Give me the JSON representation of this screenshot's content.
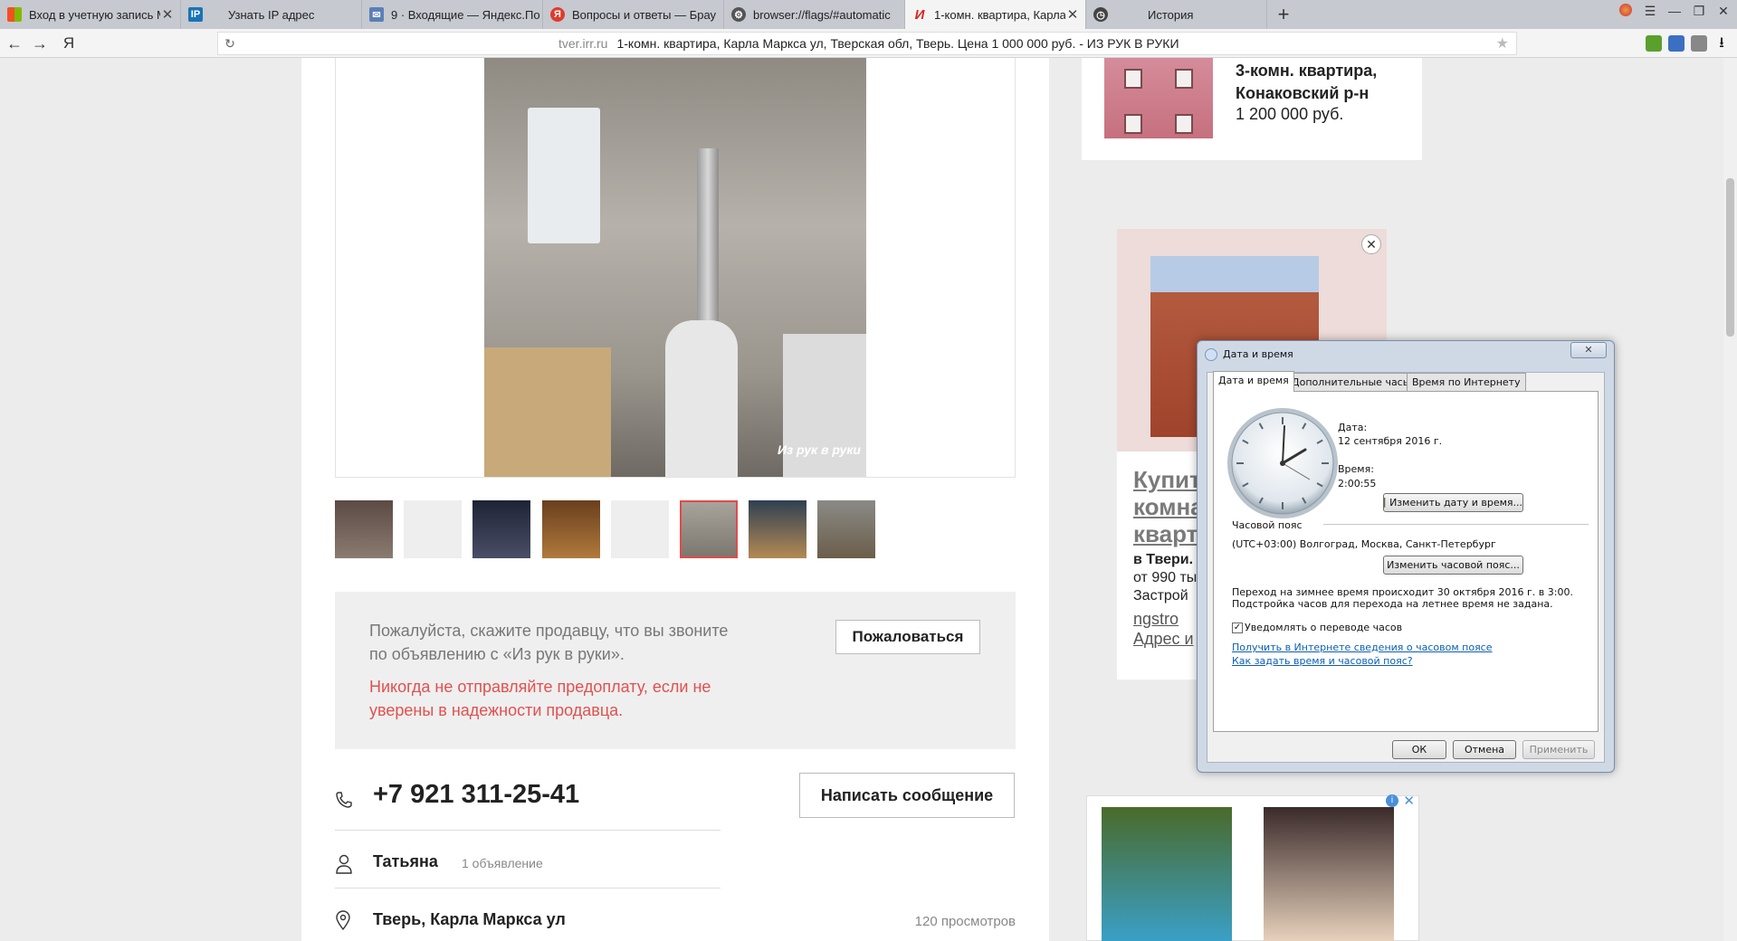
{
  "browser": {
    "tabs": [
      {
        "title": "Вход в учетную запись М",
        "icon": "microsoft-icon",
        "active": false
      },
      {
        "title": "Узнать IP адрес",
        "icon": "ip-icon",
        "active": false
      },
      {
        "title": "9 · Входящие — Яндекс.По",
        "icon": "mail-icon",
        "active": false
      },
      {
        "title": "Вопросы и ответы — Брау",
        "icon": "yandex-browser-icon",
        "active": false
      },
      {
        "title": "browser://flags/#automatic",
        "icon": "flags-icon",
        "active": false
      },
      {
        "title": "1-комн. квартира, Карла",
        "icon": "irr-icon",
        "active": true
      },
      {
        "title": "История",
        "icon": "history-icon",
        "active": false
      }
    ],
    "new_tab": "+",
    "yandex_logo": "Я",
    "url_domain": "tver.irr.ru",
    "url_title": "1-комн. квартира, Карла Маркса ул, Тверская обл, Тверь. Цена 1 000 000 руб. - ИЗ РУК В РУКИ"
  },
  "listing": {
    "watermark": "Из рук в руки",
    "notice_text": "Пожалуйста, скажите продавцу, что вы звоните по объявлению с «Из рук в руки».",
    "warning_text": "Никогда не отправляйте предоплату, если не уверены в надежности продавца.",
    "complain_button": "Пожаловаться",
    "phone": "+7 921 311-25-41",
    "message_button": "Написать сообщение",
    "seller_name": "Татьяна",
    "seller_ads": "1 объявление",
    "address": "Тверь, Карла Маркса ул",
    "views": "120 просмотров",
    "thumbnails_count": 8,
    "selected_thumbnail": 6
  },
  "recommend": {
    "title": "3-комн. квартира, Конаковский р-н",
    "price": "1 200 000 руб."
  },
  "ad": {
    "headline": "Купит комна кварт",
    "text1": "в Твери.",
    "text2": "от 990 ты",
    "text3": "Застрой",
    "link1": "ngstro",
    "link2": "Адрес и"
  },
  "dialog": {
    "title": "Дата и время",
    "close": "✕",
    "tabs": [
      "Дата и время",
      "Дополнительные часы",
      "Время по Интернету"
    ],
    "date_label": "Дата:",
    "date_value": "12 сентября 2016 г.",
    "time_label": "Время:",
    "time_value": "2:00:55",
    "change_datetime": "Изменить дату и время...",
    "timezone_label": "Часовой пояс",
    "timezone_value": "(UTC+03:00) Волгоград, Москва, Санкт-Петербург",
    "change_timezone": "Изменить часовой пояс...",
    "dst_line1": "Переход на зимнее время происходит 30 октября 2016 г. в 3:00.",
    "dst_line2": "Подстройка часов для перехода на летнее время не задана.",
    "notify_label": "Уведомлять о переводе часов",
    "notify_checked": true,
    "link1": "Получить в Интернете сведения о часовом поясе",
    "link2": "Как задать время и часовой пояс?",
    "ok": "ОК",
    "cancel": "Отмена",
    "apply": "Применить"
  }
}
